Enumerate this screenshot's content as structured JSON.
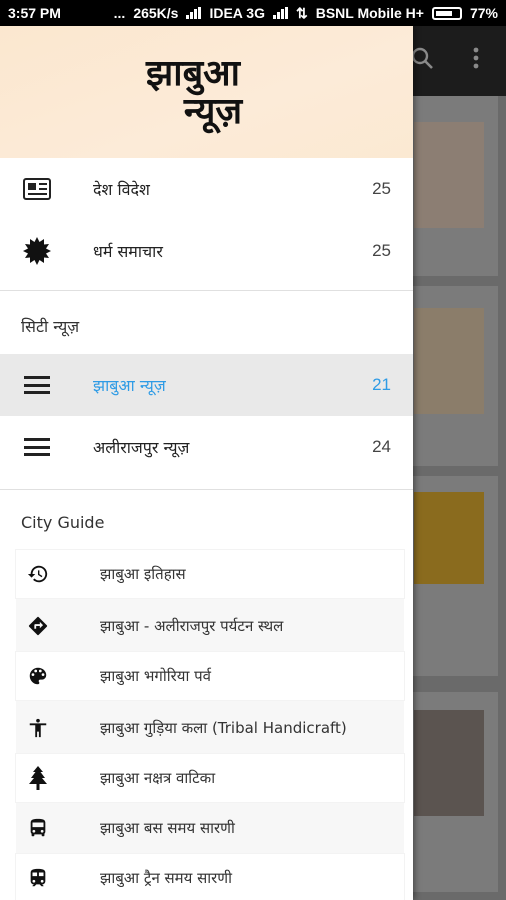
{
  "status_bar": {
    "time": "3:57 PM",
    "dots": "...",
    "speed": "265K/s",
    "carrier1": "IDEA 3G",
    "carrier2": "BSNL Mobile H+",
    "battery": "77%"
  },
  "background": {
    "search_icon": "search-icon",
    "more_icon": "more-vert-icon"
  },
  "drawer": {
    "logo_line1": "झाबुआ",
    "logo_line2": "न्यूज़",
    "top_items": [
      {
        "label": "देश विदेश",
        "count": "25",
        "icon": "newspaper-icon"
      },
      {
        "label": "धर्म समाचार",
        "count": "25",
        "icon": "sun-burst-icon"
      }
    ],
    "city_news_title": "सिटी न्यूज़",
    "city_items": [
      {
        "label": "झाबुआ न्यूज़",
        "count": "21",
        "icon": "menu-icon",
        "active": true
      },
      {
        "label": "अलीराजपुर न्यूज़",
        "count": "24",
        "icon": "menu-icon",
        "active": false
      }
    ],
    "city_guide_title": "City Guide",
    "guide_items": [
      {
        "label": "झाबुआ इतिहास",
        "icon": "history-icon"
      },
      {
        "label": "झाबुआ - अलीराजपुर पर्यटन स्थल",
        "icon": "directions-icon"
      },
      {
        "label": "झाबुआ भगोरिया पर्व",
        "icon": "palette-icon"
      },
      {
        "label": "झाबुआ गुड़िया कला (Tribal Handicraft)",
        "icon": "accessibility-icon"
      },
      {
        "label": "झाबुआ नक्षत्र वाटिका",
        "icon": "tree-icon"
      },
      {
        "label": "झाबुआ बस समय सारणी",
        "icon": "bus-icon"
      },
      {
        "label": "झाबुआ ट्रैन समय सारणी",
        "icon": "train-icon"
      }
    ]
  },
  "colors": {
    "accent": "#2e9be5",
    "header_bg": "#fbe7cf"
  }
}
